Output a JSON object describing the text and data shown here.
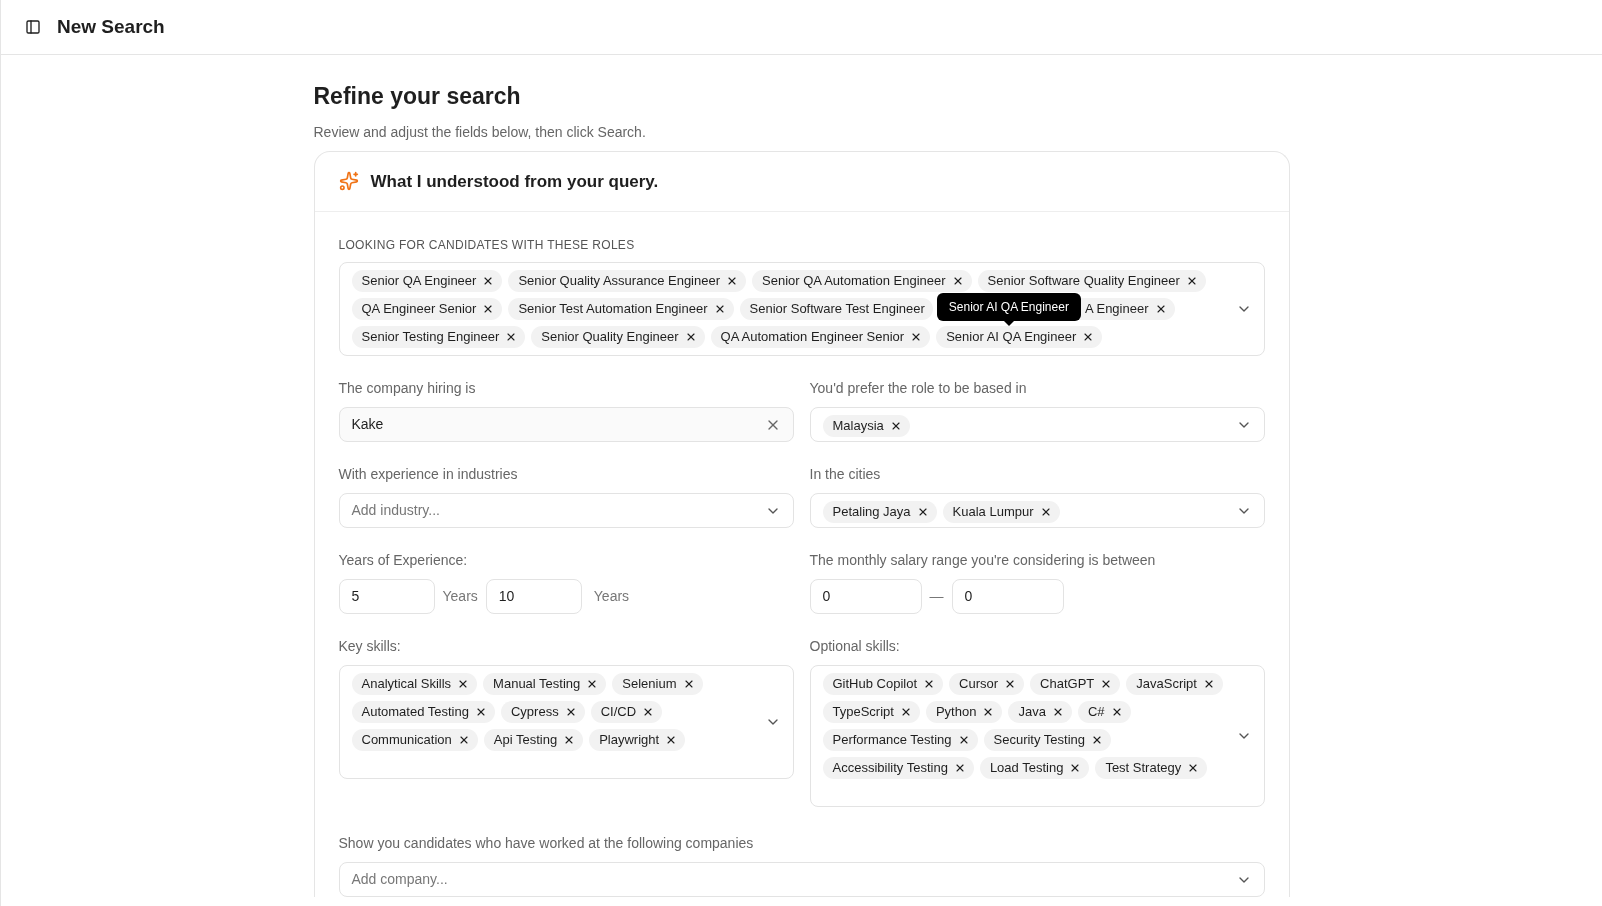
{
  "header": {
    "title": "New Search"
  },
  "heading": "Refine your search",
  "subheading": "Review and adjust the fields below, then click Search.",
  "card": {
    "title": "What I understood from your query."
  },
  "roles": {
    "label": "LOOKING FOR CANDIDATES WITH THESE ROLES",
    "tooltip": "Senior AI QA Engineer",
    "tags": [
      {
        "text": "Senior QA Engineer"
      },
      {
        "text": "Senior Quality Assurance Engineer"
      },
      {
        "text": "Senior QA Automation Engineer"
      },
      {
        "text": "Senior Software Quality Engineer"
      },
      {
        "text": "QA Engineer Senior"
      },
      {
        "text": "Senior Test Automation Engineer"
      },
      {
        "text": "Senior Software Test Engineer",
        "close_hidden": true
      },
      {
        "text": "A Engineer",
        "clipped_left": true
      },
      {
        "text": "Senior Testing Engineer"
      },
      {
        "text": "Senior Quality Engineer"
      },
      {
        "text": "QA Automation Engineer Senior"
      },
      {
        "text": "Senior AI QA Engineer"
      }
    ]
  },
  "company": {
    "label": "The company hiring is",
    "value": "Kake"
  },
  "location": {
    "label": "You'd prefer the role to be based in",
    "tags": [
      {
        "text": "Malaysia"
      }
    ]
  },
  "industries": {
    "label": "With experience in industries",
    "placeholder": "Add industry..."
  },
  "cities": {
    "label": "In the cities",
    "tags": [
      {
        "text": "Petaling Jaya"
      },
      {
        "text": "Kuala Lumpur"
      }
    ]
  },
  "experience": {
    "label": "Years of Experience:",
    "min": "5",
    "min_unit": "Years",
    "max": "10",
    "max_unit": "Years"
  },
  "salary": {
    "label": "The monthly salary range you're considering is between",
    "min": "0",
    "separator": "—",
    "max": "0"
  },
  "key_skills": {
    "label": "Key skills:",
    "tags": [
      {
        "text": "Analytical Skills"
      },
      {
        "text": "Manual Testing"
      },
      {
        "text": "Selenium"
      },
      {
        "text": "Automated Testing"
      },
      {
        "text": "Cypress"
      },
      {
        "text": "CI/CD"
      },
      {
        "text": "Communication"
      },
      {
        "text": "Api Testing"
      },
      {
        "text": "Playwright"
      }
    ]
  },
  "optional_skills": {
    "label": "Optional skills:",
    "tags": [
      {
        "text": "GitHub Copilot"
      },
      {
        "text": "Cursor"
      },
      {
        "text": "ChatGPT"
      },
      {
        "text": "JavaScript"
      },
      {
        "text": "TypeScript"
      },
      {
        "text": "Python"
      },
      {
        "text": "Java"
      },
      {
        "text": "C#"
      },
      {
        "text": "Performance Testing"
      },
      {
        "text": "Security Testing"
      },
      {
        "text": "Accessibility Testing"
      },
      {
        "text": "Load Testing"
      },
      {
        "text": "Test Strategy"
      }
    ]
  },
  "companies": {
    "label": "Show you candidates who have worked at the following companies",
    "placeholder": "Add company..."
  }
}
